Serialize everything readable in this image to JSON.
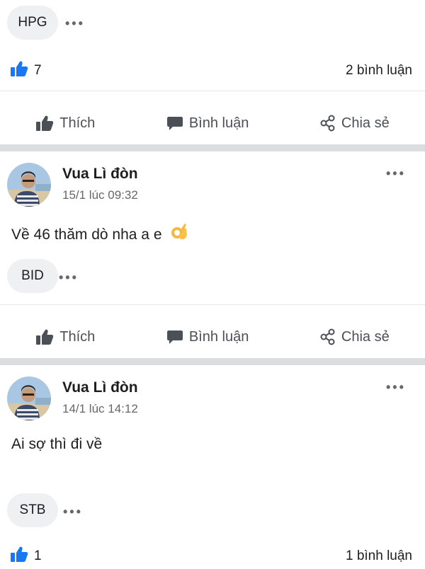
{
  "post_prev": {
    "tag": "HPG",
    "like_count": "7",
    "comment_count": "2 bình luận"
  },
  "post_1": {
    "author": "Vua Lì đòn",
    "timestamp": "15/1 lúc 09:32",
    "text": "Về 46 thăm dò nha a e",
    "tag": "BID"
  },
  "post_2": {
    "author": "Vua Lì đòn",
    "timestamp": "14/1 lúc 14:12",
    "text": "Ai sợ thì đi về",
    "tag": "STB",
    "like_count": "1",
    "comment_count": "1 bình luận"
  },
  "actions": {
    "like": "Thích",
    "comment": "Bình luận",
    "share": "Chia sẻ"
  },
  "colors": {
    "like_blue": "#1877f2",
    "action_gray": "#4b4f56",
    "chip_bg": "#eef0f2",
    "separator": "#dcdde0"
  },
  "icons": [
    "thumbs-up-icon",
    "comment-bubble-icon",
    "share-icon",
    "more-options-icon",
    "ok-hand-emoji"
  ]
}
